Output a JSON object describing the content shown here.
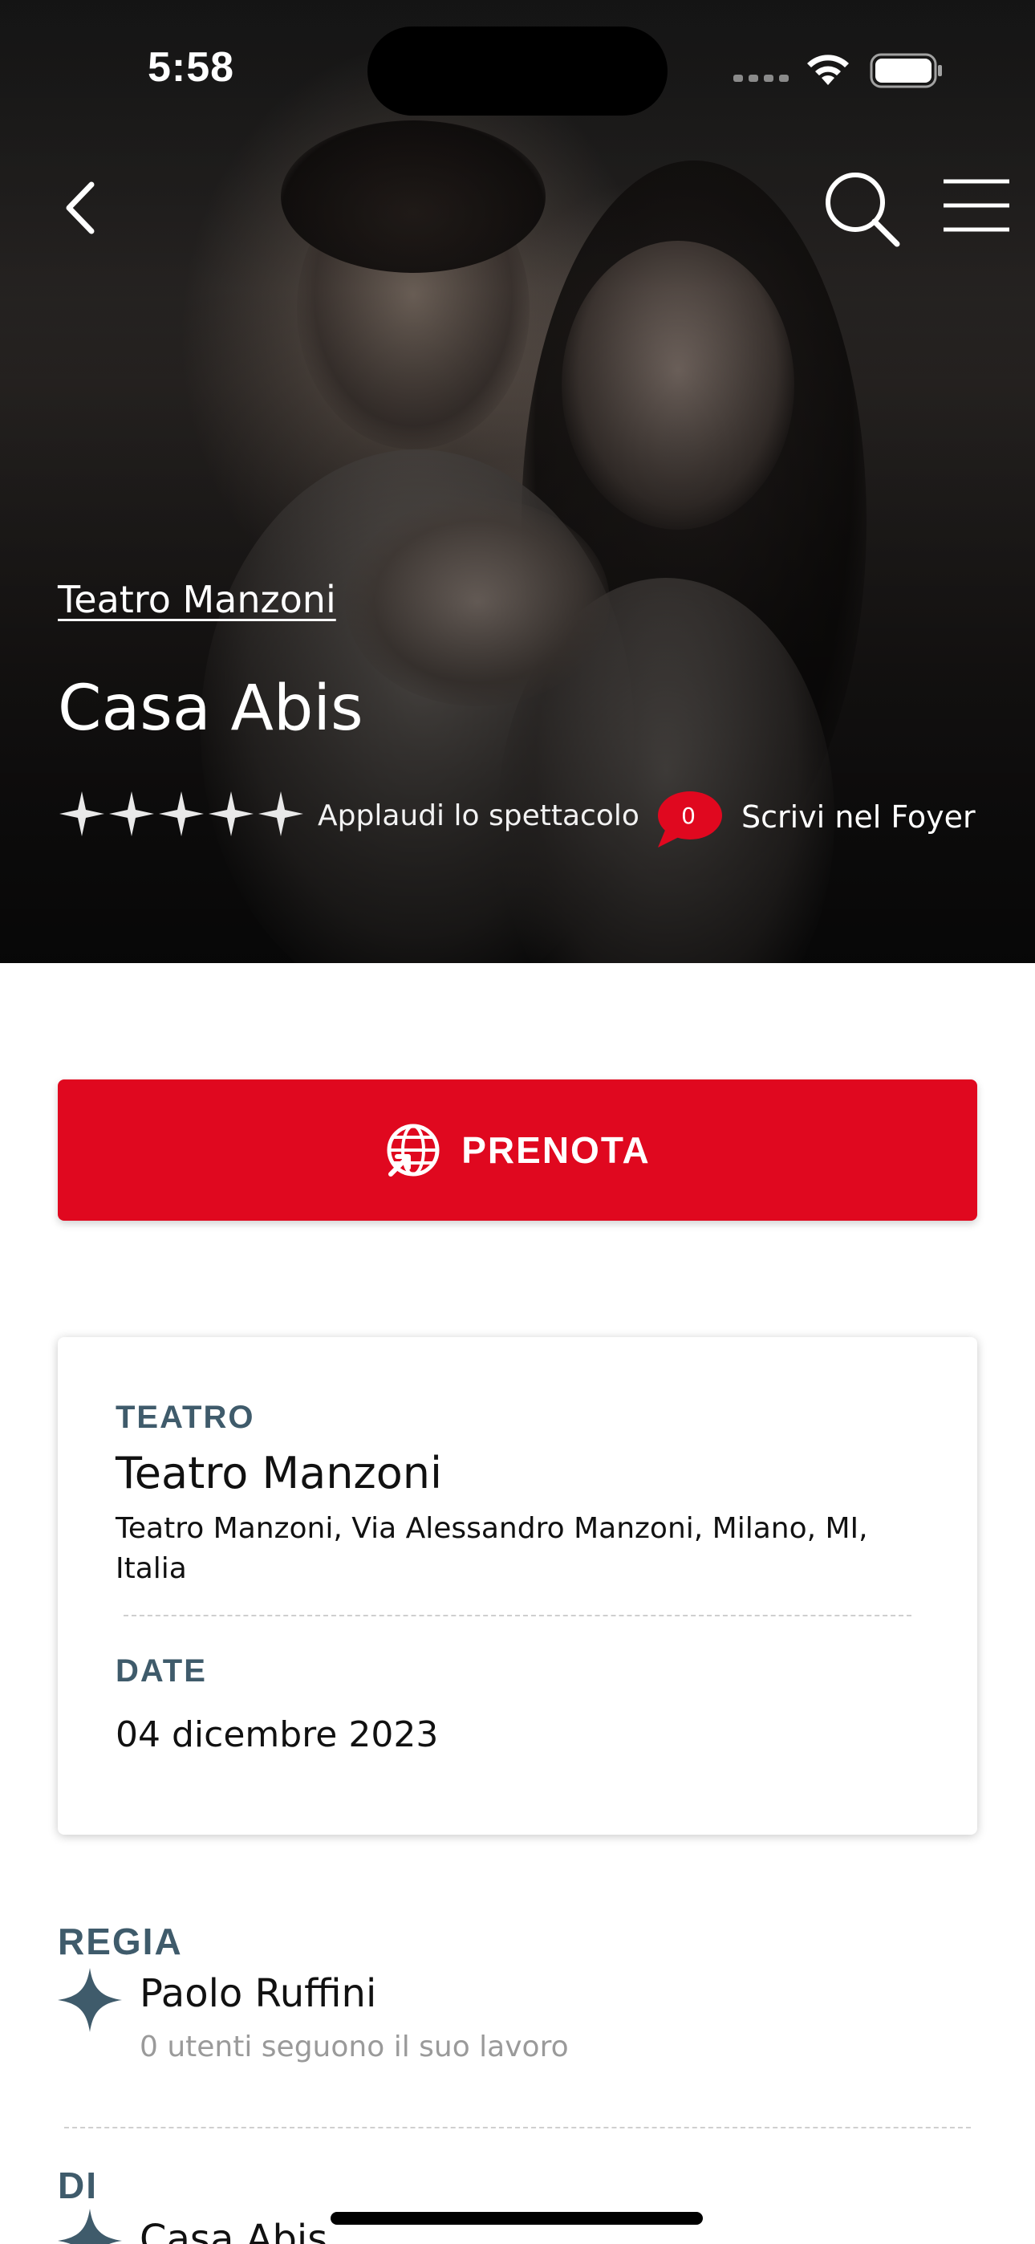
{
  "status_bar": {
    "time": "5:58"
  },
  "hero": {
    "venue_link": "Teatro Manzoni",
    "title": "Casa Abis",
    "rating_stars": 5,
    "applaud_label": "Applaudi lo spettacolo",
    "comment_count": "0",
    "foyer_label": "Scrivi nel Foyer"
  },
  "cta": {
    "label": "PRENOTA"
  },
  "info_card": {
    "theatre_label": "TEATRO",
    "theatre_name": "Teatro Manzoni",
    "theatre_address": "Teatro Manzoni, Via Alessandro Manzoni, Milano, MI, Italia",
    "date_label": "DATE",
    "date_value": "04 dicembre 2023"
  },
  "regia": {
    "label": "REGIA",
    "name": "Paolo Ruffini",
    "followers_text": "0 utenti seguono il suo lavoro"
  },
  "di": {
    "label": "DI",
    "name": "Casa Abis"
  },
  "colors": {
    "brand_red": "#e0081f",
    "label_slate": "#3f5b6b"
  }
}
